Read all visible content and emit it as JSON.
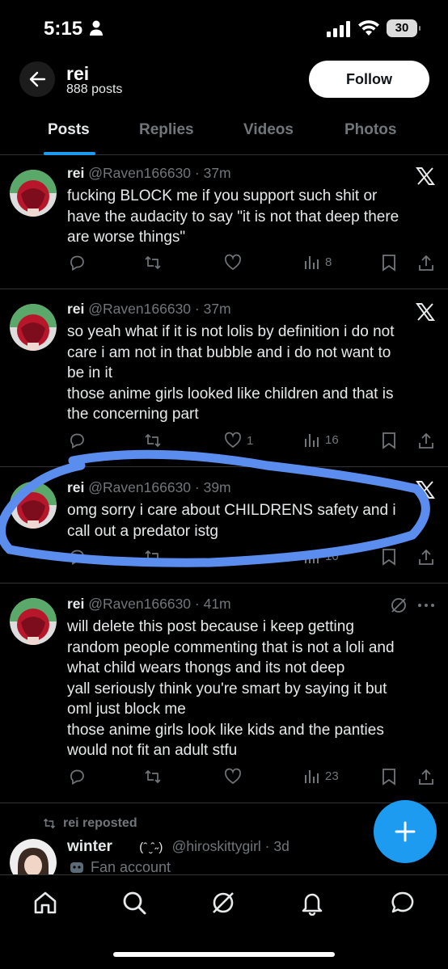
{
  "status": {
    "time": "5:15",
    "battery": "30"
  },
  "header": {
    "name": "rei",
    "posts": "888 posts",
    "follow_label": "Follow"
  },
  "tabs": [
    {
      "label": "Posts",
      "active": true
    },
    {
      "label": "Replies"
    },
    {
      "label": "Videos"
    },
    {
      "label": "Photos"
    }
  ],
  "tweets": [
    {
      "name": "rei",
      "handle": "@Raven166630 · 37m",
      "text": "fucking BLOCK me if you support such shit or\nhave the audacity to say \"it is not that deep there\nare worse things\"",
      "likes": "",
      "views": "8"
    },
    {
      "name": "rei",
      "handle": "@Raven166630 · 37m",
      "text": "so yeah what if it is not lolis by definition i do not\ncare i am not in that bubble and i do not want to\nbe in it\nthose anime girls looked like children and that is\nthe concerning part",
      "likes": "1",
      "views": "16"
    },
    {
      "name": "rei",
      "handle": "@Raven166630 · 39m",
      "text": "omg sorry i care about CHILDRENS safety and i\ncall out a predator istg",
      "views": "10"
    },
    {
      "name": "rei",
      "handle": "@Raven166630 · 41m",
      "text": "will delete this post because i keep getting\nrandom people commenting that is not a loli and\nwhat child wears thongs and its not deep\nyall seriously think you're smart by saying it but\noml just block me\nthose anime girls look like kids and the panties\nwould not fit an adult stfu",
      "views": "23"
    }
  ],
  "repost": {
    "label": "rei reposted",
    "name": "winter",
    "emoticon": "(ˆ ̮ˆ˶)",
    "handle": "@hiroskittygirl · 3d",
    "badge": "Fan account"
  },
  "colors": {
    "accent": "#1d9bf0",
    "annotation": "#5b8def"
  },
  "icons": [
    "back-arrow-icon",
    "x-logo-icon",
    "reply-icon",
    "retweet-icon",
    "like-icon",
    "views-icon",
    "bookmark-icon",
    "share-icon",
    "grok-icon",
    "more-icon",
    "home-icon",
    "search-icon",
    "notifications-icon",
    "messages-icon",
    "compose-icon"
  ]
}
